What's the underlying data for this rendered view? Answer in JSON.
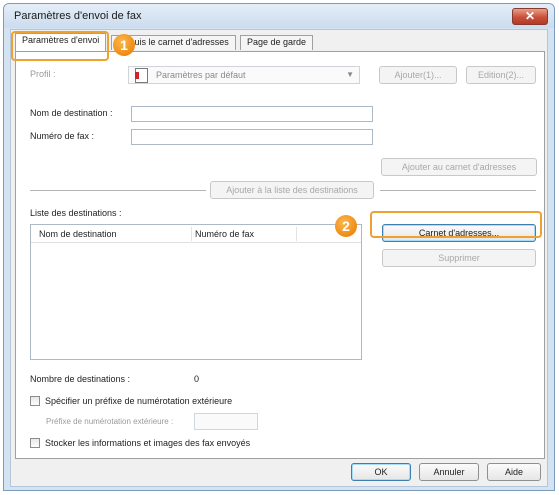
{
  "window": {
    "title": "Paramètres d'envoi de fax",
    "close_glyph": "✕"
  },
  "tabs": [
    {
      "label": "Paramètres d'envoi"
    },
    {
      "label": "Depuis le carnet d'adresses"
    },
    {
      "label": "Page de garde"
    }
  ],
  "profile": {
    "label": "Profil :",
    "value": "Paramètres par défaut",
    "add_button": "Ajouter(1)...",
    "edit_button": "Edition(2)..."
  },
  "destination": {
    "name_label": "Nom de destination :",
    "name_value": "",
    "fax_label": "Numéro de fax :",
    "fax_value": "",
    "add_to_addressbook_button": "Ajouter au carnet d'adresses",
    "add_to_list_button": "Ajouter à la liste des destinations"
  },
  "dest_list": {
    "label": "Liste des destinations :",
    "columns": [
      "Nom de destination",
      "Numéro de fax"
    ],
    "rows": []
  },
  "actions": {
    "addressbook_button": "Carnet d'adresses...",
    "delete_button": "Supprimer"
  },
  "count": {
    "label": "Nombre de destinations :",
    "value": "0"
  },
  "prefix": {
    "checkbox_label": "Spécifier un préfixe de numérotation extérieure",
    "field_label": "Préfixe de numérotation extérieure :",
    "field_value": ""
  },
  "store": {
    "checkbox_label": "Stocker les informations et images des fax envoyés"
  },
  "footer": {
    "ok": "OK",
    "cancel": "Annuler",
    "help": "Aide"
  },
  "callouts": {
    "one": "1",
    "two": "2"
  },
  "colors": {
    "callout": "#ef8a12",
    "title_bar": "#cbdcee",
    "close_button": "#c9503a",
    "default_button_border": "#3c7fb1"
  }
}
